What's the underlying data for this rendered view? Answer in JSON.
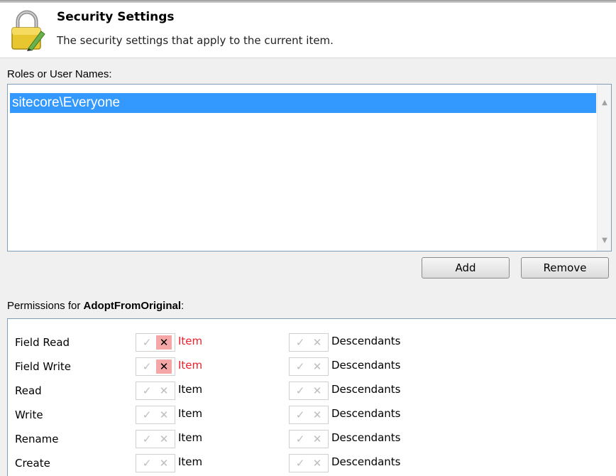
{
  "header": {
    "title": "Security Settings",
    "subtitle": "The security settings that apply to the current item.",
    "icon": "lock-icon"
  },
  "roles": {
    "label": "Roles or User Names:",
    "items": [
      "sitecore\\Everyone"
    ],
    "selected": "sitecore\\Everyone"
  },
  "buttons": {
    "add_label": "Add",
    "remove_label": "Remove"
  },
  "permissions": {
    "label_prefix": "Permissions for ",
    "item_name": "AdoptFromOriginal",
    "label_suffix": ":",
    "allow_glyph": "✓",
    "deny_glyph": "✕",
    "rows": [
      {
        "name": "Field Read",
        "item_label": "Item",
        "item_state": "denied",
        "desc_label": "Descendants",
        "desc_state": "none"
      },
      {
        "name": "Field Write",
        "item_label": "Item",
        "item_state": "denied",
        "desc_label": "Descendants",
        "desc_state": "none"
      },
      {
        "name": "Read",
        "item_label": "Item",
        "item_state": "none",
        "desc_label": "Descendants",
        "desc_state": "none"
      },
      {
        "name": "Write",
        "item_label": "Item",
        "item_state": "none",
        "desc_label": "Descendants",
        "desc_state": "none"
      },
      {
        "name": "Rename",
        "item_label": "Item",
        "item_state": "none",
        "desc_label": "Descendants",
        "desc_state": "none"
      },
      {
        "name": "Create",
        "item_label": "Item",
        "item_state": "none",
        "desc_label": "Descendants",
        "desc_state": "none"
      }
    ]
  },
  "colors": {
    "selection": "#3399ff",
    "denied_text": "#e8202a",
    "denied_bg": "#f5a7a7",
    "border": "#7f9db9"
  }
}
